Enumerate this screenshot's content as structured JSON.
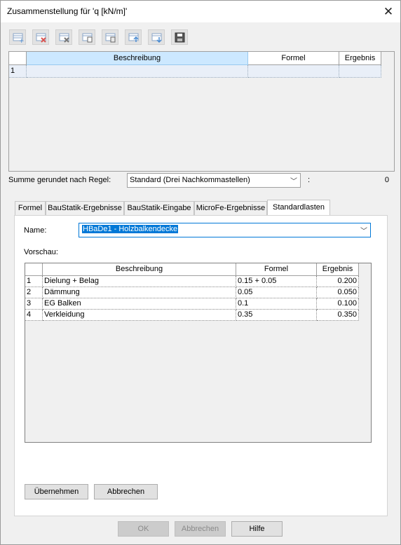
{
  "window": {
    "title": "Zusammenstellung für 'q [kN/m]'"
  },
  "toolbar": {
    "icons": [
      "insert-row-icon",
      "delete-row-icon",
      "delete-all-icon",
      "copy-icon",
      "paste-icon",
      "move-up-icon",
      "move-down-icon",
      "save-icon"
    ]
  },
  "top_grid": {
    "columns": [
      "Beschreibung",
      "Formel",
      "Ergebnis"
    ],
    "rows": [
      {
        "num": "1",
        "beschreibung": "",
        "formel": "",
        "ergebnis": ""
      }
    ]
  },
  "sum": {
    "label": "Summe gerundet nach Regel:",
    "rule": "Standard (Drei Nachkommastellen)",
    "colon": ":",
    "value": "0"
  },
  "tabs": [
    {
      "label": "Formel"
    },
    {
      "label": "BauStatik-Ergebnisse"
    },
    {
      "label": "BauStatik-Eingabe"
    },
    {
      "label": "MicroFe-Ergebnisse"
    },
    {
      "label": "Standardlasten",
      "active": true
    }
  ],
  "panel": {
    "name_label": "Name:",
    "name_value": "HBaDe1 - Holzbalkendecke",
    "vorschau_label": "Vorschau:",
    "preview": {
      "columns": [
        "Beschreibung",
        "Formel",
        "Ergebnis"
      ],
      "rows": [
        {
          "num": "1",
          "beschreibung": "Dielung + Belag",
          "formel": "0.15 + 0.05",
          "ergebnis": "0.200"
        },
        {
          "num": "2",
          "beschreibung": "Dämmung",
          "formel": "0.05",
          "ergebnis": "0.050"
        },
        {
          "num": "3",
          "beschreibung": "EG Balken",
          "formel": "0.1",
          "ergebnis": "0.100"
        },
        {
          "num": "4",
          "beschreibung": "Verkleidung",
          "formel": "0.35",
          "ergebnis": "0.350"
        }
      ]
    },
    "apply_button": "Übernehmen",
    "cancel_button": "Abbrechen"
  },
  "footer": {
    "ok": "OK",
    "cancel": "Abbrechen",
    "help": "Hilfe"
  }
}
